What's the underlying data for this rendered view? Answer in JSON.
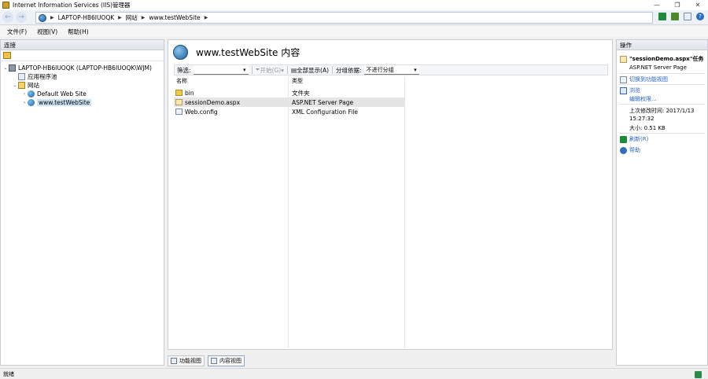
{
  "window": {
    "title": "Internet Information Services (IIS)管理器"
  },
  "address": {
    "crumbs": [
      "LAPTOP-HB6IUOQK",
      "网站",
      "www.testWebSite"
    ]
  },
  "menu": [
    "文件(F)",
    "视图(V)",
    "帮助(H)"
  ],
  "connections": {
    "title": "连接",
    "server": "LAPTOP-HB6IUOQK (LAPTOP-HB6IUOQK\\WJM)",
    "app_pools": "应用程序池",
    "sites": "网站",
    "site1": "Default Web Site",
    "site2": "www.testWebSite"
  },
  "content": {
    "heading": "www.testWebSite 内容",
    "filter_label": "筛选:",
    "start_label": "开始(G)",
    "show_all_label": "全部显示(A)",
    "group_label": "分组依据:",
    "group_value": "不进行分组",
    "col_name": "名称",
    "col_type": "类型",
    "rows": [
      {
        "name": "bin",
        "type": "文件夹",
        "icon": "folder-icon"
      },
      {
        "name": "sessionDemo.aspx",
        "type": "ASP.NET Server Page",
        "icon": "aspx-file-icon"
      },
      {
        "name": "Web.config",
        "type": "XML Configuration File",
        "icon": "config-file-icon"
      }
    ]
  },
  "bottom_tabs": {
    "features": "功能视图",
    "content": "内容视图"
  },
  "actions": {
    "title": "操作",
    "task_title": "\"sessionDemo.aspx\"任务",
    "task_type": "ASP.NET Server Page",
    "switch_view": "切换到功能视图",
    "browse": "浏览",
    "edit_permissions": "编辑权限...",
    "last_modified_label": "上次修改时间: 2017/1/13",
    "last_modified_time": "15:27:32",
    "size": "大小: 0.51 KB",
    "refresh": "刷新(R)",
    "help": "帮助"
  },
  "status": {
    "text": "就绪"
  }
}
